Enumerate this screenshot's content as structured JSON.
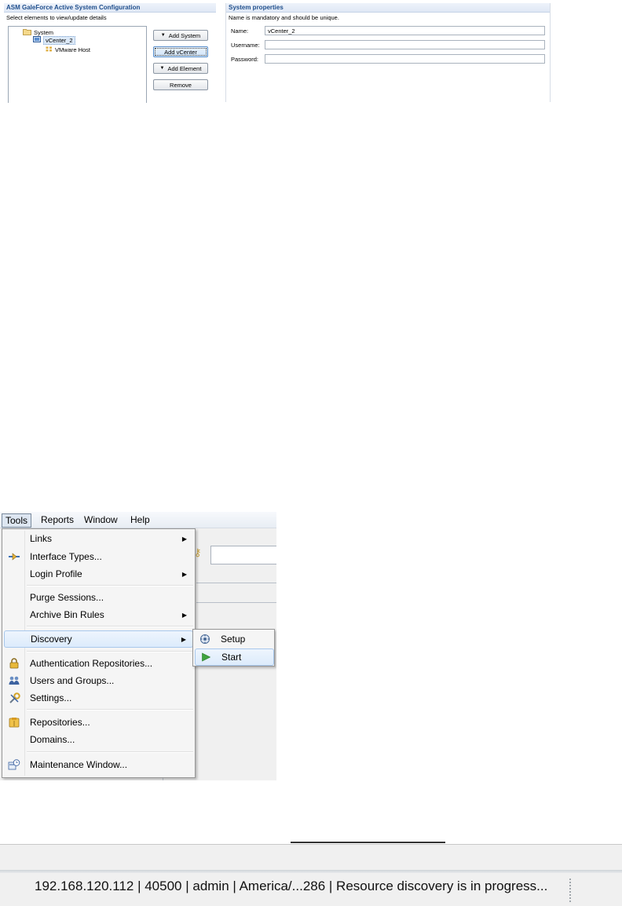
{
  "config": {
    "title": "ASM GaleForce Active System Configuration",
    "subtitle": "Select elements to view/update details",
    "tree": [
      {
        "label": "System",
        "icon": "folder-icon"
      },
      {
        "label": "vCenter_2",
        "icon": "monitor-icon",
        "selected": true
      },
      {
        "label": "VMware Host",
        "icon": "host-icon"
      }
    ],
    "buttons": {
      "add_system": "Add System",
      "add_vcenter": "Add vCenter",
      "add_element": "Add Element",
      "remove": "Remove"
    },
    "properties": {
      "title": "System properties",
      "note": "Name is mandatory and should be unique.",
      "name_label": "Name:",
      "name_value": "vCenter_2",
      "username_label": "Username:",
      "username_value": "",
      "password_label": "Password:",
      "password_value": ""
    }
  },
  "menu": {
    "menubar": [
      "Tools",
      "Reports",
      "Window",
      "Help"
    ],
    "items": [
      {
        "label": "Links",
        "icon": "",
        "submenu": true
      },
      {
        "label": "Interface Types...",
        "icon": "interface-icon",
        "submenu": false
      },
      {
        "label": "Login Profile",
        "icon": "",
        "submenu": true
      },
      {
        "label": "Purge Sessions...",
        "icon": "",
        "submenu": false
      },
      {
        "label": "Archive Bin Rules",
        "icon": "",
        "submenu": true
      },
      {
        "label": "Discovery",
        "icon": "",
        "submenu": true,
        "highlighted": true
      },
      {
        "label": "Authentication Repositories...",
        "icon": "lock-icon",
        "submenu": false
      },
      {
        "label": "Users and Groups...",
        "icon": "users-icon",
        "submenu": false
      },
      {
        "label": "Settings...",
        "icon": "settings-icon",
        "submenu": false
      },
      {
        "label": "Repositories...",
        "icon": "repository-icon",
        "submenu": false
      },
      {
        "label": "Domains...",
        "icon": "",
        "submenu": false
      },
      {
        "label": "Maintenance Window...",
        "icon": "maintenance-icon",
        "submenu": false
      }
    ],
    "discovery_submenu": [
      {
        "label": "Setup",
        "icon": "setup-icon"
      },
      {
        "label": "Start",
        "icon": "play-icon",
        "highlighted": true
      }
    ]
  },
  "status": {
    "text": "192.168.120.112 | 40500 | admin | America/...286 | Resource discovery is in progress..."
  },
  "colors": {
    "section_title": "#1f4e8c",
    "menu_highlight": "#dcebfc",
    "play_green": "#3fa33f"
  }
}
